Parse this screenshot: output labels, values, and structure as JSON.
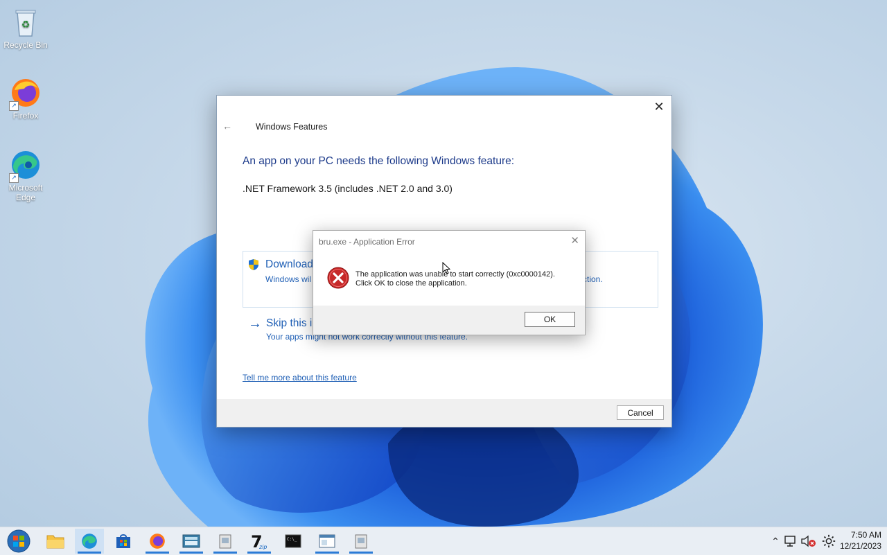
{
  "desktop": {
    "icons": [
      {
        "label": "Recycle Bin",
        "icon": "recycle-bin-icon"
      },
      {
        "label": "Firefox",
        "icon": "firefox-icon"
      },
      {
        "label": "Microsoft Edge",
        "icon": "edge-icon"
      }
    ]
  },
  "windows_features": {
    "title": "Windows Features",
    "heading": "An app on your PC needs the following Windows feature:",
    "feature": ".NET Framework 3.5 (includes .NET 2.0 and 3.0)",
    "download_option": {
      "title": "Download",
      "subtitle": "Windows wil",
      "subtitle_tail": "ction."
    },
    "skip_option": {
      "title": "Skip this i",
      "subtitle": "Your apps might not work correctly without this feature."
    },
    "tell_more_link": "Tell me more about this feature",
    "cancel_label": "Cancel"
  },
  "error_dialog": {
    "title": "bru.exe - Application Error",
    "message_line1": "The application was unable to start correctly (0xc0000142).",
    "message_line2": "Click OK to close the application.",
    "ok_label": "OK"
  },
  "taskbar": {
    "items": [
      {
        "icon": "start-button-icon"
      },
      {
        "icon": "file-explorer-icon"
      },
      {
        "icon": "edge-icon",
        "active": true
      },
      {
        "icon": "store-icon"
      },
      {
        "icon": "firefox-icon"
      },
      {
        "icon": "keyboard-app-icon"
      },
      {
        "icon": "installer-icon"
      },
      {
        "icon": "7zip-icon",
        "label": "7z"
      },
      {
        "icon": "terminal-icon"
      },
      {
        "icon": "window-app-icon"
      },
      {
        "icon": "installer-icon"
      }
    ],
    "clock": {
      "time": "7:50 AM",
      "date": "12/21/2023"
    }
  },
  "colors": {
    "accent": "#1f5fb5",
    "heading": "#1c3a8a",
    "error_red": "#c62828"
  }
}
